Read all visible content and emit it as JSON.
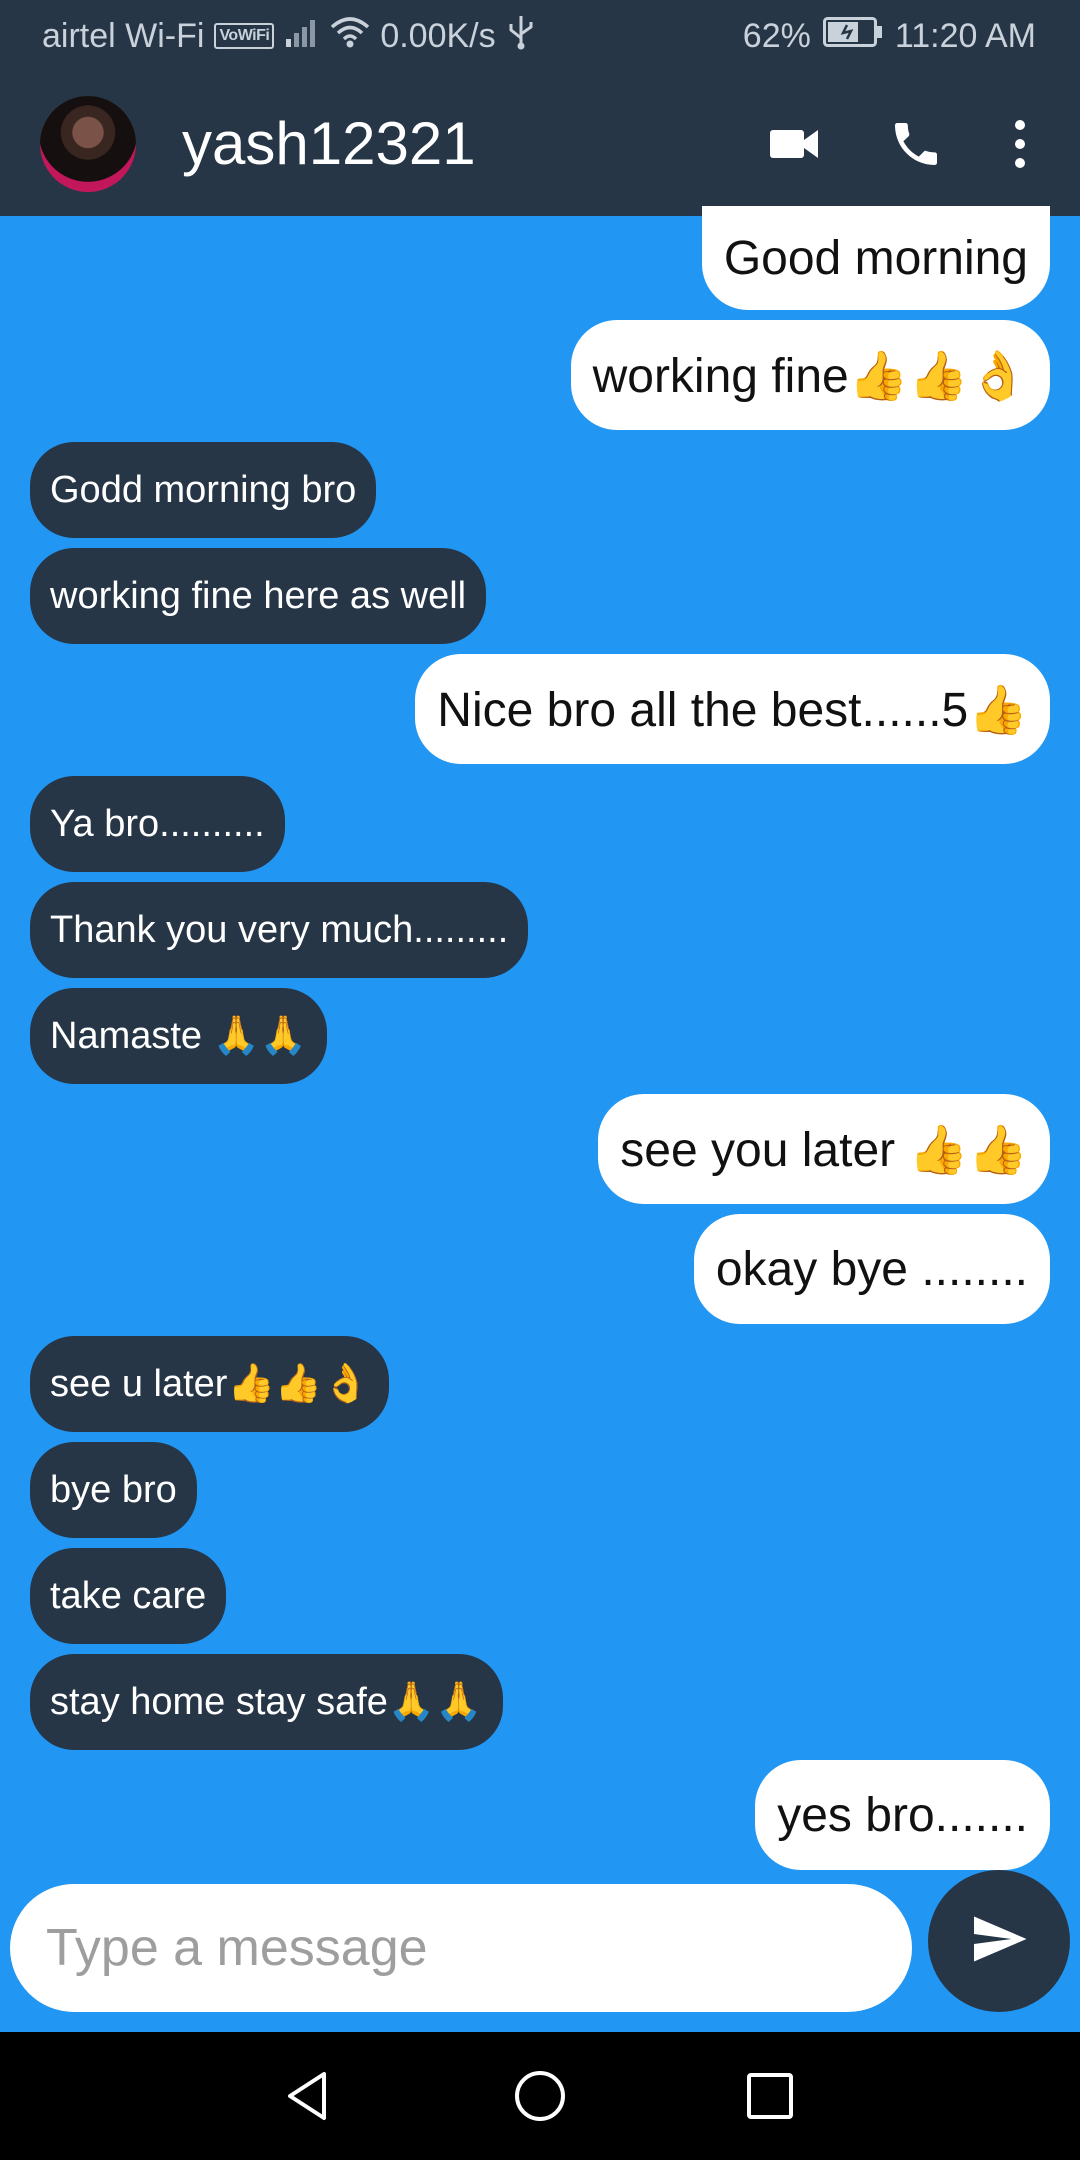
{
  "status_bar": {
    "carrier": "airtel Wi-Fi",
    "vowifi_badge": "VoWiFi",
    "speed": "0.00K/s",
    "battery": "62%",
    "time": "11:20 AM"
  },
  "header": {
    "contact_name": "yash12321",
    "icons": [
      "video-call-icon",
      "phone-icon",
      "more-vert-icon"
    ]
  },
  "messages": [
    {
      "text": "Good morning",
      "dir": "out"
    },
    {
      "text": "working fine👍👍👌",
      "dir": "out"
    },
    {
      "text": "Godd morning bro",
      "dir": "in"
    },
    {
      "text": "working fine here as well",
      "dir": "in"
    },
    {
      "text": "Nice bro all the best......5👍",
      "dir": "out"
    },
    {
      "text": "Ya bro..........",
      "dir": "in"
    },
    {
      "text": "Thank you very much.........",
      "dir": "in"
    },
    {
      "text": "Namaste 🙏🙏",
      "dir": "in"
    },
    {
      "text": "see you later 👍👍",
      "dir": "out"
    },
    {
      "text": "okay bye ........",
      "dir": "out"
    },
    {
      "text": "see u later👍👍👌",
      "dir": "in"
    },
    {
      "text": "bye bro",
      "dir": "in"
    },
    {
      "text": "take care",
      "dir": "in"
    },
    {
      "text": "stay home stay safe🙏🙏",
      "dir": "in"
    },
    {
      "text": "yes bro.......",
      "dir": "out"
    }
  ],
  "composer": {
    "placeholder": "Type a message"
  },
  "colors": {
    "background": "#2196f3",
    "bar": "#263646",
    "incoming_bubble": "#263646",
    "outgoing_bubble": "#ffffff"
  }
}
